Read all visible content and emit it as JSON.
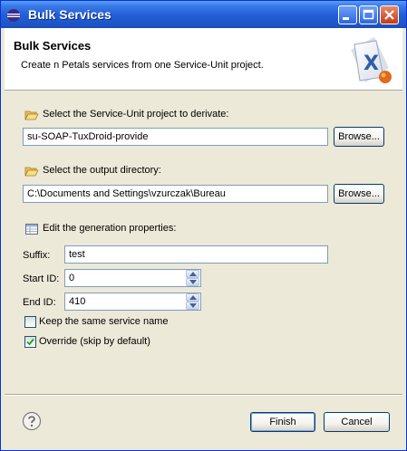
{
  "window": {
    "title": "Bulk Services",
    "controls": {
      "minimize_icon": "minimize-icon",
      "maximize_icon": "maximize-icon",
      "close_icon": "close-icon"
    }
  },
  "header": {
    "title": "Bulk Services",
    "description": "Create n Petals services from one Service-Unit project.",
    "banner_icon": "xml-wizard-icon"
  },
  "project_section": {
    "label": "Select the Service-Unit project to derivate:",
    "icon": "folder-open-icon",
    "value": "su-SOAP-TuxDroid-provide",
    "browse_label": "Browse..."
  },
  "output_section": {
    "label": "Select the output directory:",
    "icon": "folder-open-icon",
    "value": "C:\\Documents and Settings\\vzurczak\\Bureau",
    "browse_label": "Browse..."
  },
  "properties_section": {
    "label": "Edit the generation properties:",
    "icon": "table-icon",
    "suffix_label": "Suffix:",
    "suffix_value": "test",
    "start_id_label": "Start ID:",
    "start_id_value": "0",
    "end_id_label": "End ID:",
    "end_id_value": "410",
    "keep_name_label": "Keep the same service name",
    "keep_name_checked": false,
    "override_label": "Override (skip by default)",
    "override_checked": true
  },
  "footer": {
    "help_icon": "help-icon",
    "finish_label": "Finish",
    "cancel_label": "Cancel"
  },
  "colors": {
    "titlebar": "#2360d8",
    "dialog_bg": "#ece9d8",
    "field_border": "#7f9db9",
    "close_button": "#c73a1a"
  }
}
